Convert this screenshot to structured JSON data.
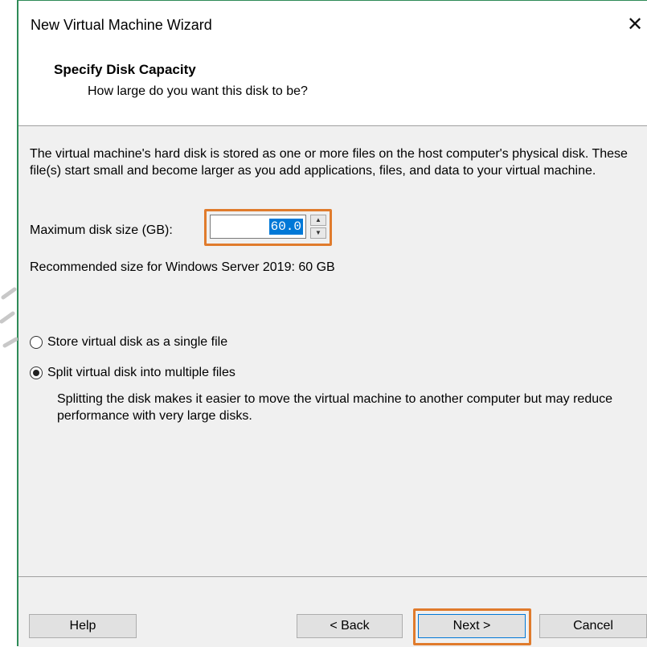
{
  "window": {
    "title": "New Virtual Machine Wizard",
    "close_glyph": "✕"
  },
  "header": {
    "title": "Specify Disk Capacity",
    "subtitle": "How large do you want this disk to be?"
  },
  "body": {
    "description": "The virtual machine's hard disk is stored as one or more files on the host computer's physical disk. These file(s) start small and become larger as you add applications, files, and data to your virtual machine.",
    "disk_size_label": "Maximum disk size (GB):",
    "disk_size_value": "60.0",
    "recommended": "Recommended size for Windows Server 2019: 60 GB",
    "options": [
      {
        "label": "Store virtual disk as a single file",
        "selected": false
      },
      {
        "label": "Split virtual disk into multiple files",
        "selected": true
      }
    ],
    "split_note": "Splitting the disk makes it easier to move the virtual machine to another computer but may reduce performance with very large disks."
  },
  "footer": {
    "help_label": "Help",
    "back_label": "< Back",
    "next_label": "Next >",
    "cancel_label": "Cancel"
  },
  "colors": {
    "highlight_border": "#e07b2c",
    "selection": "#0078d7",
    "window_bg": "#f0f0f0"
  }
}
